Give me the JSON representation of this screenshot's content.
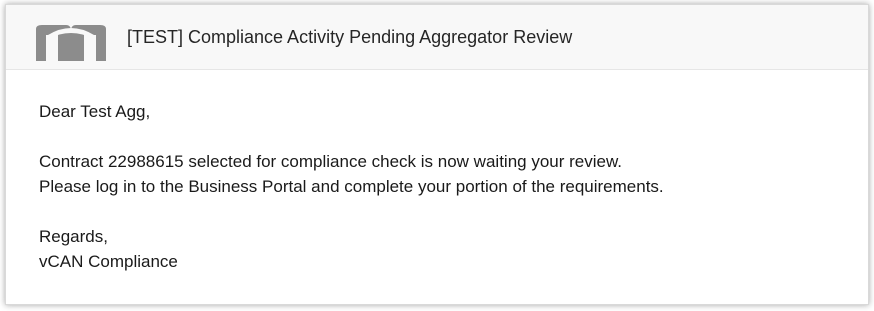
{
  "email": {
    "subject": "[TEST] Compliance Activity Pending Aggregator Review",
    "greeting": "Dear Test Agg,",
    "line1": "Contract 22988615 selected for compliance check is now waiting your review.",
    "line2": "Please log in to the Business Portal and complete your portion of the requirements.",
    "closing": "Regards,",
    "signature": "vCAN Compliance"
  },
  "icons": {
    "logo": "m-logo-icon"
  },
  "colors": {
    "header_bg": "#f8f8f8",
    "logo_gray": "#8c8c8c",
    "text": "#1a1a1a"
  }
}
